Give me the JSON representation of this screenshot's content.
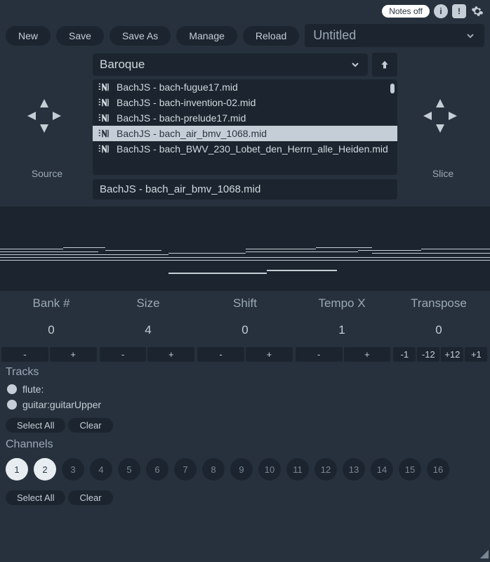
{
  "topbar": {
    "notes_off": "Notes off",
    "info_glyph": "i",
    "alert_glyph": "!"
  },
  "toolbar": {
    "new_": "New",
    "save": "Save",
    "save_as": "Save As",
    "manage": "Manage",
    "reload": "Reload",
    "title": "Untitled"
  },
  "browser": {
    "folder": "Baroque",
    "files": [
      {
        "name": "BachJS - bach-fugue17.mid"
      },
      {
        "name": "BachJS - bach-invention-02.mid"
      },
      {
        "name": "BachJS - bach-prelude17.mid"
      },
      {
        "name": "BachJS - bach_air_bmv_1068.mid"
      },
      {
        "name": "BachJS - bach_BWV_230_Lobet_den_Herrn_alle_Heiden.mid"
      }
    ],
    "selected": "BachJS - bach_air_bmv_1068.mid",
    "source_label": "Source",
    "slice_label": "Slice"
  },
  "params": {
    "labels": {
      "bank": "Bank #",
      "size": "Size",
      "shift": "Shift",
      "tempo": "Tempo X",
      "transpose": "Transpose"
    },
    "values": {
      "bank": "0",
      "size": "4",
      "shift": "0",
      "tempo": "1",
      "transpose": "0"
    },
    "minus": "-",
    "plus": "+",
    "transpose_steps": [
      "-1",
      "-12",
      "+12",
      "+1"
    ]
  },
  "tracks": {
    "label": "Tracks",
    "items": [
      "flute:",
      "guitar:guitarUpper"
    ],
    "select_all": "Select All",
    "clear": "Clear"
  },
  "channels": {
    "label": "Channels",
    "numbers": [
      "1",
      "2",
      "3",
      "4",
      "5",
      "6",
      "7",
      "8",
      "9",
      "10",
      "11",
      "12",
      "13",
      "14",
      "15",
      "16"
    ],
    "active": [
      0,
      1
    ],
    "select_all": "Select All",
    "clear": "Clear"
  }
}
